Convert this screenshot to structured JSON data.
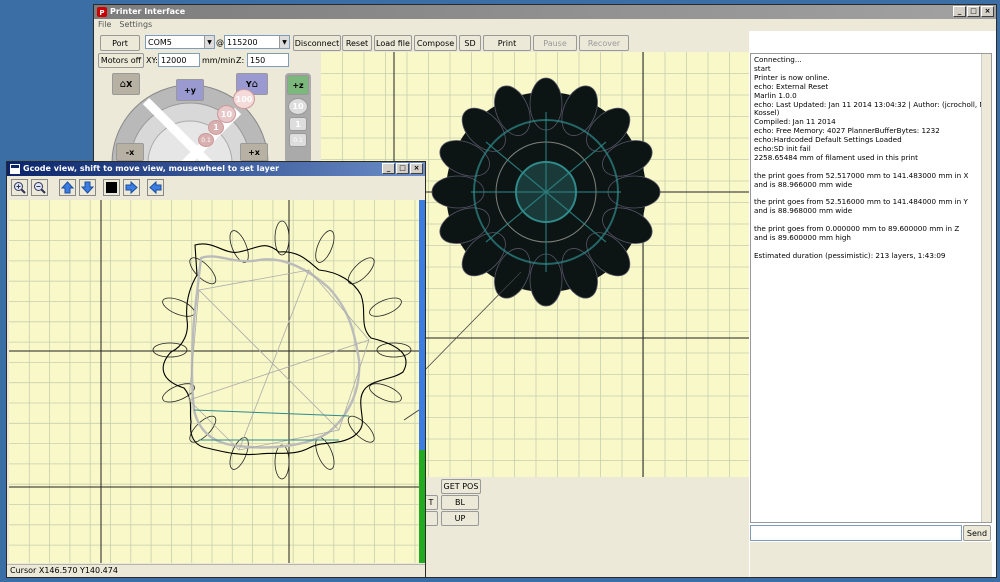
{
  "main_window": {
    "title": "Printer Interface",
    "menu": [
      "File",
      "Settings"
    ],
    "toolbar": {
      "port_label": "Port",
      "port_value": "COM5",
      "at_sign": "@",
      "baud_value": "115200",
      "disconnect_label": "Disconnect",
      "reset_label": "Reset",
      "load_label": "Load file",
      "compose_label": "Compose",
      "sd_label": "SD",
      "print_label": "Print",
      "pause_label": "Pause",
      "recover_label": "Recover"
    },
    "controls": {
      "motors_off_label": "Motors off",
      "xy_label": "XY:",
      "xy_value": "12000",
      "mm_min_label": "mm/min",
      "z_label": "Z:",
      "z_value": "150"
    },
    "jog": {
      "home_x_label": "X",
      "home_y_label": "Y",
      "plus_y": "+y",
      "minus_x": "-x",
      "plus_x": "+x",
      "plus_z": "+z",
      "steps": [
        "100",
        "10",
        "1",
        "0.1"
      ],
      "z_steps": [
        "10",
        "1",
        "0.1"
      ]
    },
    "extra_buttons": {
      "get_pos": "GET POS",
      "bl": "BL",
      "up": "UP",
      "t_fragment": "T"
    },
    "console": {
      "lines": [
        "Connecting...",
        "start",
        "Printer is now online.",
        "echo: External Reset",
        "Marlin 1.0.0",
        "echo: Last Updated: Jan 11 2014 13:04:32 | Author: (jcrocholl, Mini",
        "Kossel)",
        "Compiled: Jan 11 2014",
        "echo: Free Memory: 4027  PlannerBufferBytes: 1232",
        "echo:Hardcoded Default Settings Loaded",
        "echo:SD init fail",
        "2258.65484 mm of filament used in this print",
        "",
        "the print goes from 52.517000 mm to 141.483000 mm in X",
        "and is 88.966000 mm wide",
        "",
        "the print goes from 52.516000 mm to 141.484000 mm in Y",
        "and is 88.968000 mm wide",
        "",
        "the print goes from 0.000000 mm to 89.600000 mm in Z",
        "and is 89.600000 mm high",
        "",
        "Estimated duration (pessimistic):  213 layers, 1:43:09"
      ],
      "input_value": "",
      "send_label": "Send"
    }
  },
  "gcode_window": {
    "title": "Gcode view, shift to move view, mousewheel to set layer",
    "toolbar_icons": [
      "zoom-in-icon",
      "zoom-out-icon",
      "layer-up-icon",
      "layer-down-icon",
      "reset-view-icon",
      "next-layer-icon",
      "prev-layer-icon"
    ],
    "status": "Cursor X146.570 Y140.474"
  },
  "colors": {
    "desktop": "#3a6ea5",
    "plot_bg": "#f8f8c8",
    "grid": "#c9cfae",
    "active_title": "#0a246a",
    "model_teal": "#2f8a8a",
    "layer_bar": "#22aa22"
  }
}
